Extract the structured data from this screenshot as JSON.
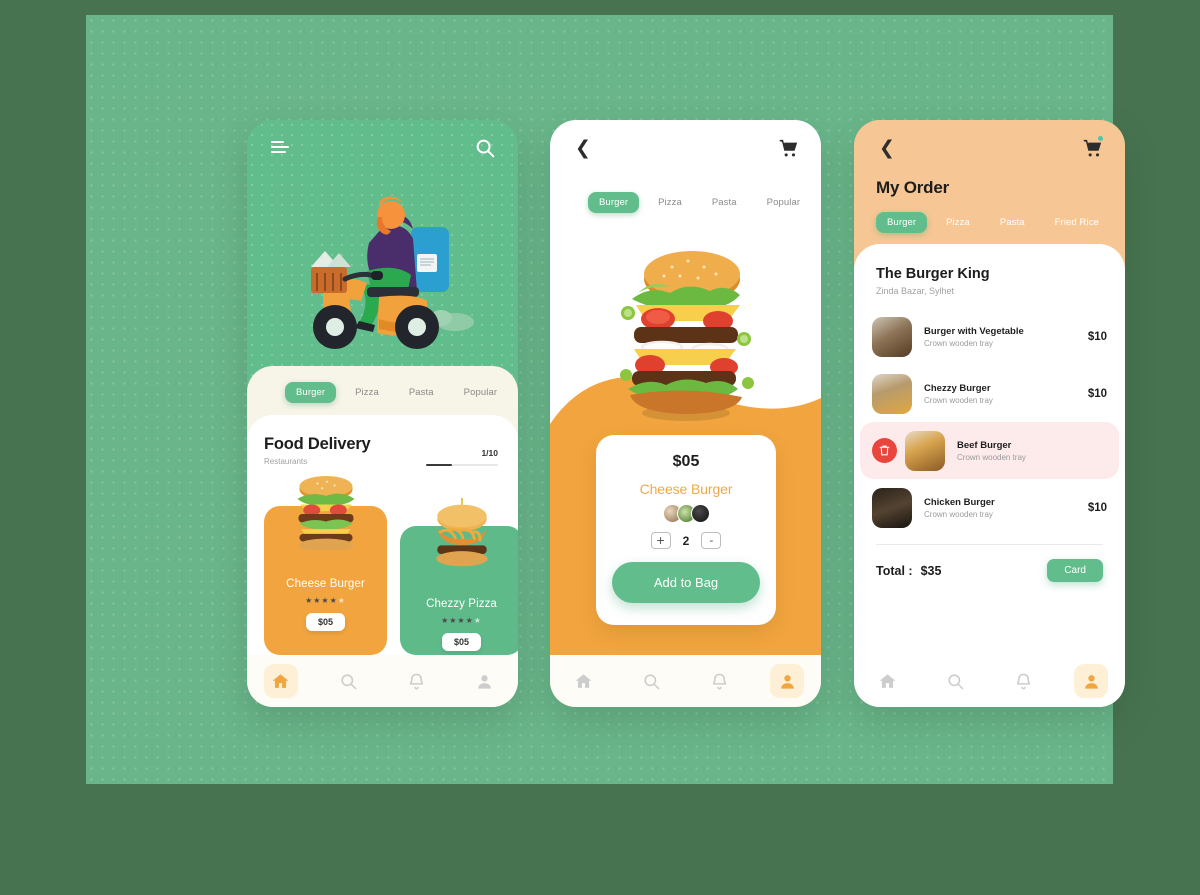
{
  "theme": {
    "page_bg": "#487350",
    "canvas_bg": "#6ab58a",
    "green": "#62bd8c",
    "orange": "#f2a53e",
    "peach": "#f6c694",
    "cream": "#f7f4e8",
    "danger": "#e8453c",
    "danger_bg": "#fdeaea"
  },
  "screen1": {
    "menu_icon": "hamburger-menu-icon",
    "search_icon": "search-icon",
    "illustration": "scooter-delivery-illustration",
    "tabs": [
      {
        "label": "Burger",
        "active": true
      },
      {
        "label": "Pizza",
        "active": false
      },
      {
        "label": "Pasta",
        "active": false
      },
      {
        "label": "Popular",
        "active": false
      }
    ],
    "title": "Food Delivery",
    "subtitle": "Restaurants",
    "pager": "1/10",
    "cards": [
      {
        "name": "Cheese Burger",
        "price": "$05",
        "stars": 4,
        "stars_total": 5,
        "color": "orange"
      },
      {
        "name": "Chezzy Pizza",
        "price": "$05",
        "stars": 4,
        "stars_total": 5,
        "color": "green"
      }
    ],
    "nav": [
      {
        "icon": "home-icon",
        "active": true
      },
      {
        "icon": "search-icon",
        "active": false
      },
      {
        "icon": "bell-icon",
        "active": false
      },
      {
        "icon": "user-icon",
        "active": false
      }
    ]
  },
  "screen2": {
    "back_icon": "chevron-left-icon",
    "cart_icon": "shopping-cart-icon",
    "tabs": [
      {
        "label": "Burger",
        "active": true
      },
      {
        "label": "Pizza",
        "active": false
      },
      {
        "label": "Pasta",
        "active": false
      },
      {
        "label": "Popular",
        "active": false
      }
    ],
    "hero_image": "stacked-burger-photo",
    "detail": {
      "price": "$05",
      "name": "Cheese Burger",
      "avatars": [
        "ingredient-thumb-1",
        "ingredient-thumb-2",
        "ingredient-thumb-3"
      ],
      "increase_label": "+",
      "quantity": "2",
      "decrease_label": "-",
      "add_button": "Add to Bag"
    },
    "nav": [
      {
        "icon": "home-icon",
        "active": false
      },
      {
        "icon": "search-icon",
        "active": false
      },
      {
        "icon": "bell-icon",
        "active": false
      },
      {
        "icon": "user-icon",
        "active": true
      }
    ]
  },
  "screen3": {
    "back_icon": "chevron-left-icon",
    "cart_icon": "shopping-cart-icon",
    "cart_badge": true,
    "title": "My Order",
    "tabs": [
      {
        "label": "Burger",
        "active": true
      },
      {
        "label": "Pizza",
        "active": false
      },
      {
        "label": "Pasta",
        "active": false
      },
      {
        "label": "Fried Rice",
        "active": false
      }
    ],
    "restaurant": "The Burger King",
    "address": "Zinda Bazar, Sylhet",
    "items": [
      {
        "name": "Burger with Vegetable",
        "desc": "Crown wooden tray",
        "price": "$10",
        "swiped": false
      },
      {
        "name": "Chezzy Burger",
        "desc": "Crown wooden tray",
        "price": "$10",
        "swiped": false
      },
      {
        "name": "Beef Burger",
        "desc": "Crown wooden tray",
        "price": "",
        "swiped": true,
        "delete_icon": "trash-icon"
      },
      {
        "name": "Chicken Burger",
        "desc": "Crown wooden tray",
        "price": "$10",
        "swiped": false
      }
    ],
    "total_label": "Total :",
    "total_value": "$35",
    "pay_button": "Card",
    "nav": [
      {
        "icon": "home-icon",
        "active": false
      },
      {
        "icon": "search-icon",
        "active": false
      },
      {
        "icon": "bell-icon",
        "active": false
      },
      {
        "icon": "user-icon",
        "active": true
      }
    ]
  }
}
